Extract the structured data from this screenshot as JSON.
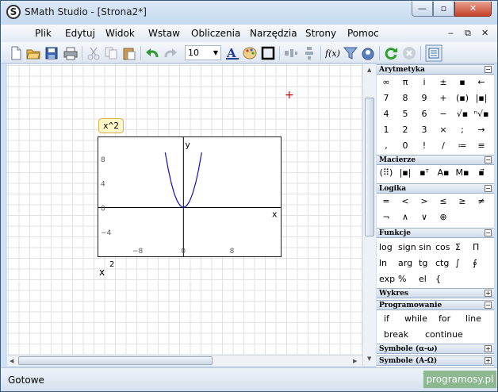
{
  "window": {
    "title": "SMath Studio - [Strona2*]",
    "logo": "S",
    "minimize": "—",
    "maximize": "▫",
    "close": "✕"
  },
  "menu": {
    "items": [
      "Plik",
      "Edytuj",
      "Widok",
      "Wstaw",
      "Obliczenia",
      "Narzędzia",
      "Strony",
      "Pomoc"
    ],
    "mdi_controls": [
      "‒",
      "⧉",
      "✕"
    ]
  },
  "toolbar": {
    "font_size": "10",
    "fx_label": "f(x)"
  },
  "document": {
    "expression": "x^2",
    "result_base": "x",
    "result_exp": "2",
    "cursor": "+",
    "plot": {
      "y_axis_label": "y",
      "x_axis_label": "x",
      "y_ticks": [
        "8",
        "4",
        "0",
        "−4"
      ],
      "x_ticks": [
        "−8",
        "0",
        "8"
      ]
    }
  },
  "chart_data": {
    "type": "line",
    "series": [
      {
        "x": [
          -3,
          -2.5,
          -2,
          -1.5,
          -1,
          -0.5,
          0,
          0.5,
          1,
          1.5,
          2,
          2.5,
          3
        ],
        "y": [
          9,
          6.25,
          4,
          2.25,
          1,
          0.25,
          0,
          0.25,
          1,
          2.25,
          4,
          6.25,
          9
        ]
      }
    ],
    "xlim": [
      -14,
      16
    ],
    "ylim": [
      -8,
      11.5
    ],
    "x_ticks": [
      -8,
      0,
      8
    ],
    "y_ticks": [
      8,
      4,
      0,
      -4
    ],
    "xlabel": "x",
    "ylabel": "y",
    "title": "",
    "grid": false
  },
  "status": {
    "text": "Gotowe",
    "watermark": "programosy.pl"
  },
  "panels": {
    "arytmetyka": {
      "title": "Arytmetyka",
      "rows": [
        [
          "∞",
          "π",
          "i",
          "±",
          "▪",
          "←"
        ],
        [
          "7",
          "8",
          "9",
          "+",
          "(▪)",
          "|▪|"
        ],
        [
          "4",
          "5",
          "6",
          "−",
          "√▪",
          "ⁿ√▪"
        ],
        [
          "1",
          "2",
          "3",
          "×",
          ";",
          "→"
        ],
        [
          ",",
          "0",
          "!",
          "/",
          "≔",
          "≡"
        ]
      ]
    },
    "macierze": {
      "title": "Macierze",
      "items": [
        "(⠿)",
        "|▪|",
        "▪ᵀ",
        "A▪",
        "M▪",
        "▪⃗"
      ]
    },
    "logika": {
      "title": "Logika",
      "rows": [
        [
          "=",
          "<",
          ">",
          "≤",
          "≥",
          "≠"
        ],
        [
          "¬",
          "∧",
          "∨",
          "⊕"
        ]
      ]
    },
    "funkcje": {
      "title": "Funkcje",
      "rows": [
        [
          "log",
          "sign",
          "sin",
          "cos",
          "Σ",
          "Π"
        ],
        [
          "ln",
          "arg",
          "tg",
          "ctg",
          "∫",
          "∮"
        ],
        [
          "exp",
          "%",
          "el",
          "{"
        ]
      ]
    },
    "wykres": {
      "title": "Wykres"
    },
    "programowanie": {
      "title": "Programowanie",
      "rows": [
        [
          "if",
          "while",
          "for",
          "line"
        ],
        [
          "break",
          "continue"
        ]
      ]
    },
    "symbole1": {
      "title": "Symbole (α-ω)"
    },
    "symbole2": {
      "title": "Symbole (Α-Ω)"
    },
    "toggle_open": "−",
    "toggle_closed": "+"
  }
}
